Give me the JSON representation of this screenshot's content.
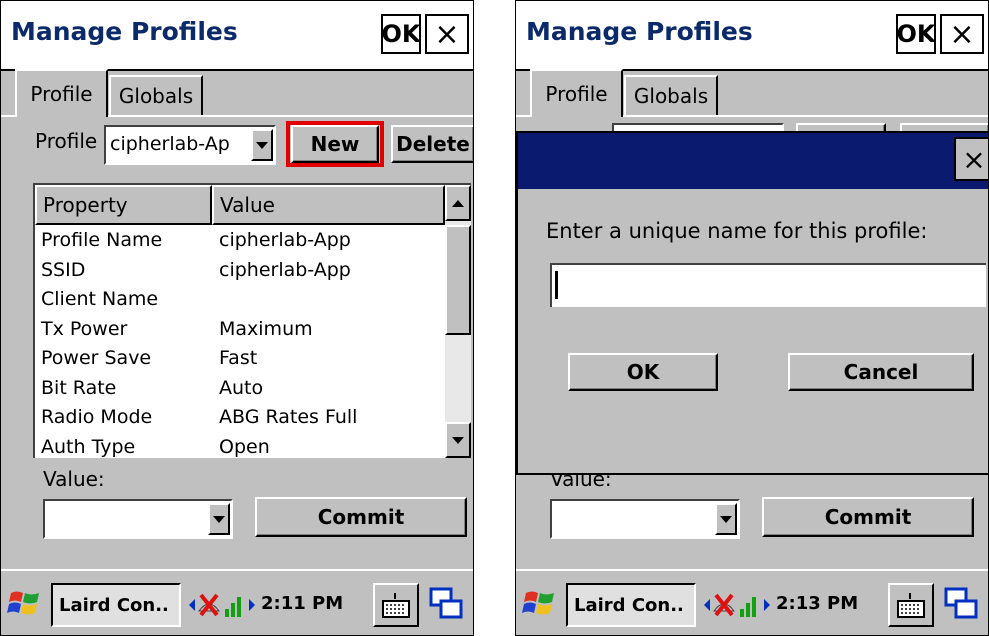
{
  "left": {
    "title": "Manage Profiles",
    "ok_label": "OK",
    "close_label": "×",
    "tabs": [
      {
        "label": "Profile"
      },
      {
        "label": "Globals"
      }
    ],
    "profile_label": "Profile",
    "profile_value": "cipherlab-Ap",
    "new_label": "New",
    "delete_label": "Delete",
    "columns": {
      "property": "Property",
      "value": "Value"
    },
    "rows": [
      {
        "property": "Profile Name",
        "value": "cipherlab-App"
      },
      {
        "property": "SSID",
        "value": "cipherlab-App"
      },
      {
        "property": "Client Name",
        "value": ""
      },
      {
        "property": "Tx Power",
        "value": "Maximum"
      },
      {
        "property": "Power Save",
        "value": "Fast"
      },
      {
        "property": "Bit Rate",
        "value": "Auto"
      },
      {
        "property": "Radio Mode",
        "value": "ABG Rates Full"
      },
      {
        "property": "Auth Type",
        "value": "Open"
      }
    ],
    "value_label": "Value:",
    "commit_label": "Commit",
    "taskbar": {
      "app_label": "Laird Con..",
      "time": "2:11 PM"
    }
  },
  "right": {
    "title": "Manage Profiles",
    "ok_label": "OK",
    "close_label": "×",
    "tabs": [
      {
        "label": "Profile"
      },
      {
        "label": "Globals"
      }
    ],
    "dialog": {
      "close_label": "×",
      "prompt": "Enter a unique name for this profile:",
      "input_value": "",
      "ok_label": "OK",
      "cancel_label": "Cancel"
    },
    "value_label": "Value:",
    "commit_label": "Commit",
    "taskbar": {
      "app_label": "Laird Con..",
      "time": "2:13 PM"
    }
  },
  "colors": {
    "title_text": "#0a2a6a",
    "dialog_title_bar": "#0a1a6e",
    "highlight": "#e00000",
    "face": "#c0c0c0"
  },
  "icons": [
    "windows-start-icon",
    "arrow-left-icon",
    "network-error-icon",
    "signal-bars-icon",
    "arrow-right-icon",
    "keyboard-icon",
    "window-switch-icon"
  ]
}
